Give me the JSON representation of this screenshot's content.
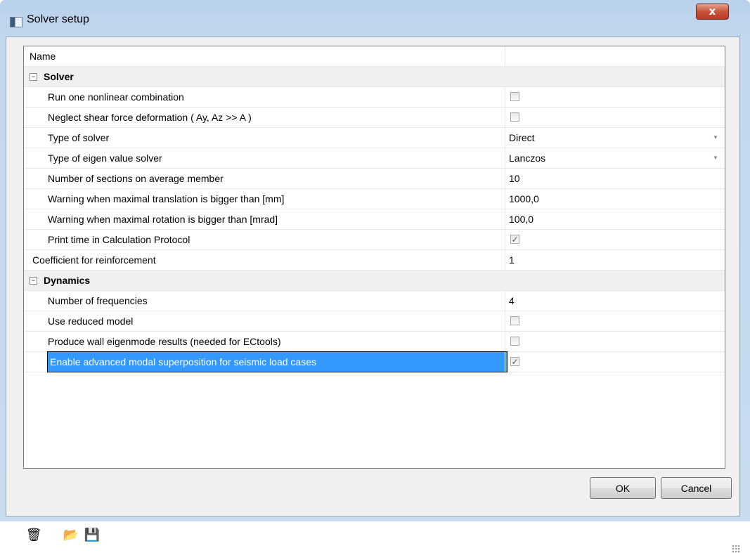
{
  "window": {
    "title": "Solver setup",
    "close_label": "x"
  },
  "grid": {
    "header": "Name",
    "rows": [
      {
        "kind": "category",
        "label": "Solver",
        "toggle": "−"
      },
      {
        "kind": "prop",
        "label": "Run one nonlinear combination",
        "checked": false
      },
      {
        "kind": "prop",
        "label": "Neglect shear force deformation ( Ay, Az >> A )",
        "checked": false
      },
      {
        "kind": "prop",
        "label": "Type of solver",
        "value": "Direct",
        "dropdown": true
      },
      {
        "kind": "prop",
        "label": "Type of eigen value solver",
        "value": "Lanczos",
        "dropdown": true
      },
      {
        "kind": "prop",
        "label": "Number of sections on average member",
        "value": "10"
      },
      {
        "kind": "prop",
        "label": "Warning when maximal translation is bigger than [mm]",
        "value": "1000,0"
      },
      {
        "kind": "prop",
        "label": "Warning when maximal rotation is bigger than [mrad]",
        "value": "100,0"
      },
      {
        "kind": "prop",
        "label": "Print time in Calculation Protocol",
        "checked": true
      },
      {
        "kind": "top",
        "label": "Coefficient for reinforcement",
        "value": "1"
      },
      {
        "kind": "category",
        "label": "Dynamics",
        "toggle": "−"
      },
      {
        "kind": "prop",
        "label": "Number of frequencies",
        "value": "4"
      },
      {
        "kind": "prop",
        "label": "Use reduced model",
        "checked": false
      },
      {
        "kind": "prop",
        "label": "Produce wall eigenmode results (needed for ECtools)",
        "checked": false
      },
      {
        "kind": "prop",
        "label": "Enable advanced modal superposition for seismic load cases",
        "checked": true,
        "selected": true
      }
    ]
  },
  "footer": {
    "tools": [
      {
        "name": "clear-icon",
        "glyph": "🗑"
      },
      {
        "name": "open-folder-icon",
        "glyph": "📂"
      },
      {
        "name": "save-icon",
        "glyph": "💾"
      }
    ],
    "ok_label": "OK",
    "cancel_label": "Cancel"
  },
  "colors": {
    "selection": "#3399ff",
    "close": "#c8543a"
  }
}
